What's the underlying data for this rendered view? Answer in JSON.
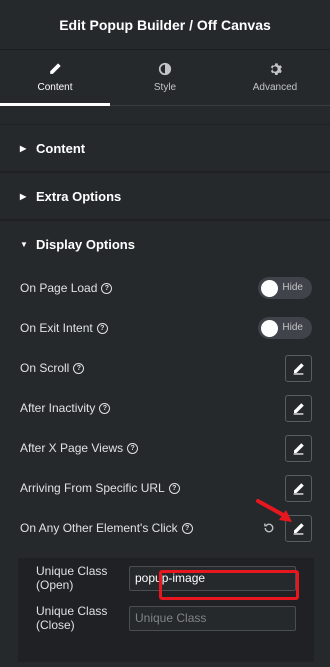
{
  "header": {
    "title": "Edit Popup Builder / Off Canvas"
  },
  "tabs": [
    {
      "label": "Content",
      "icon": "pencil-icon",
      "active": true
    },
    {
      "label": "Style",
      "icon": "half-circle-icon"
    },
    {
      "label": "Advanced",
      "icon": "gear-icon"
    }
  ],
  "sections": {
    "content": "Content",
    "extra": "Extra Options",
    "display": "Display Options"
  },
  "display_options": {
    "on_page_load": {
      "label": "On Page Load",
      "toggle": "Hide"
    },
    "on_exit_intent": {
      "label": "On Exit Intent",
      "toggle": "Hide"
    },
    "on_scroll": {
      "label": "On Scroll"
    },
    "after_inactivity": {
      "label": "After Inactivity"
    },
    "after_x_page_views": {
      "label": "After X Page Views"
    },
    "arriving_from_url": {
      "label": "Arriving From Specific URL"
    },
    "on_element_click": {
      "label": "On Any Other Element's Click"
    }
  },
  "click_panel": {
    "open_label": "Unique Class (Open)",
    "open_value": "popup-image",
    "close_label": "Unique Class (Close)",
    "close_placeholder": "Unique Class"
  },
  "colors": {
    "background": "#26292c",
    "highlight": "#e8171f"
  }
}
